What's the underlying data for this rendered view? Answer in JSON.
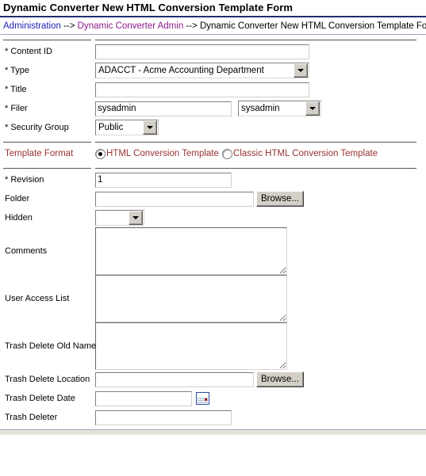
{
  "header": {
    "title": "Dynamic Converter New HTML Conversion Template Form",
    "breadcrumb": {
      "administration": "Administration",
      "sep1": " --> ",
      "dynamic_converter_admin": "Dynamic Converter Admin",
      "sep2": " --> ",
      "current": "Dynamic Converter New HTML Conversion Template Form"
    }
  },
  "colors": {
    "title_rule": "#1d2f6e",
    "link": "#2222bb",
    "visited_link": "#8b1a8b",
    "accent_maroon": "#993333",
    "field_border": "#808080",
    "button_face": "#d4d0c8"
  },
  "form": {
    "rows": [
      {
        "label": "* Content ID",
        "type": "text",
        "value": ""
      },
      {
        "label": "* Type",
        "type": "select",
        "value": "ADACCT - Acme Accounting Department"
      },
      {
        "label": "* Title",
        "type": "text",
        "value": ""
      },
      {
        "label": "* Filer",
        "type": "text+select",
        "value": "sysadmin",
        "value2": "sysadmin"
      },
      {
        "label": "* Security Group",
        "type": "select",
        "value": "Public"
      },
      {
        "label": "Template Format",
        "type": "radio"
      },
      {
        "label": "* Revision",
        "type": "text",
        "value": "1"
      },
      {
        "label": "Folder",
        "type": "text+browse",
        "value": "",
        "button": "Browse..."
      },
      {
        "label": "Hidden",
        "type": "select",
        "value": ""
      },
      {
        "label": "Comments",
        "type": "textarea",
        "value": ""
      },
      {
        "label": "User Access List",
        "type": "textarea",
        "value": ""
      },
      {
        "label": "Trash Delete Old Name",
        "type": "textarea",
        "value": ""
      },
      {
        "label": "Trash Delete Location",
        "type": "text+browse",
        "value": "",
        "button": "Browse..."
      },
      {
        "label": "Trash Delete Date",
        "type": "text+calendar",
        "value": ""
      },
      {
        "label": "Trash Deleter",
        "type": "text",
        "value": ""
      }
    ],
    "labels": {
      "content_id": "* Content ID",
      "type": "* Type",
      "title": "* Title",
      "filer": "* Filer",
      "security_group": "* Security Group",
      "template_format": "Template Format",
      "revision": "* Revision",
      "folder": "Folder",
      "hidden": "Hidden",
      "comments": "Comments",
      "user_access_list": "User Access List",
      "trash_delete_old_name": "Trash Delete Old Name",
      "trash_delete_location": "Trash Delete Location",
      "trash_delete_date": "Trash Delete Date",
      "trash_deleter": "Trash Deleter"
    },
    "values": {
      "content_id": "",
      "type": "ADACCT - Acme Accounting Department",
      "title": "",
      "filer_name": "sysadmin",
      "filer_select": "sysadmin",
      "security_group": "Public",
      "revision": "1",
      "folder": "",
      "hidden": "",
      "comments": "",
      "user_access_list": "",
      "trash_delete_old_name": "",
      "trash_delete_location": "",
      "trash_delete_date": "",
      "trash_deleter": ""
    },
    "template_format": {
      "option1": "HTML Conversion Template",
      "option2": "Classic HTML Conversion Template",
      "selected": "HTML Conversion Template"
    },
    "buttons": {
      "folder_browse": "Browse...",
      "trash_location_browse": "Browse..."
    }
  }
}
